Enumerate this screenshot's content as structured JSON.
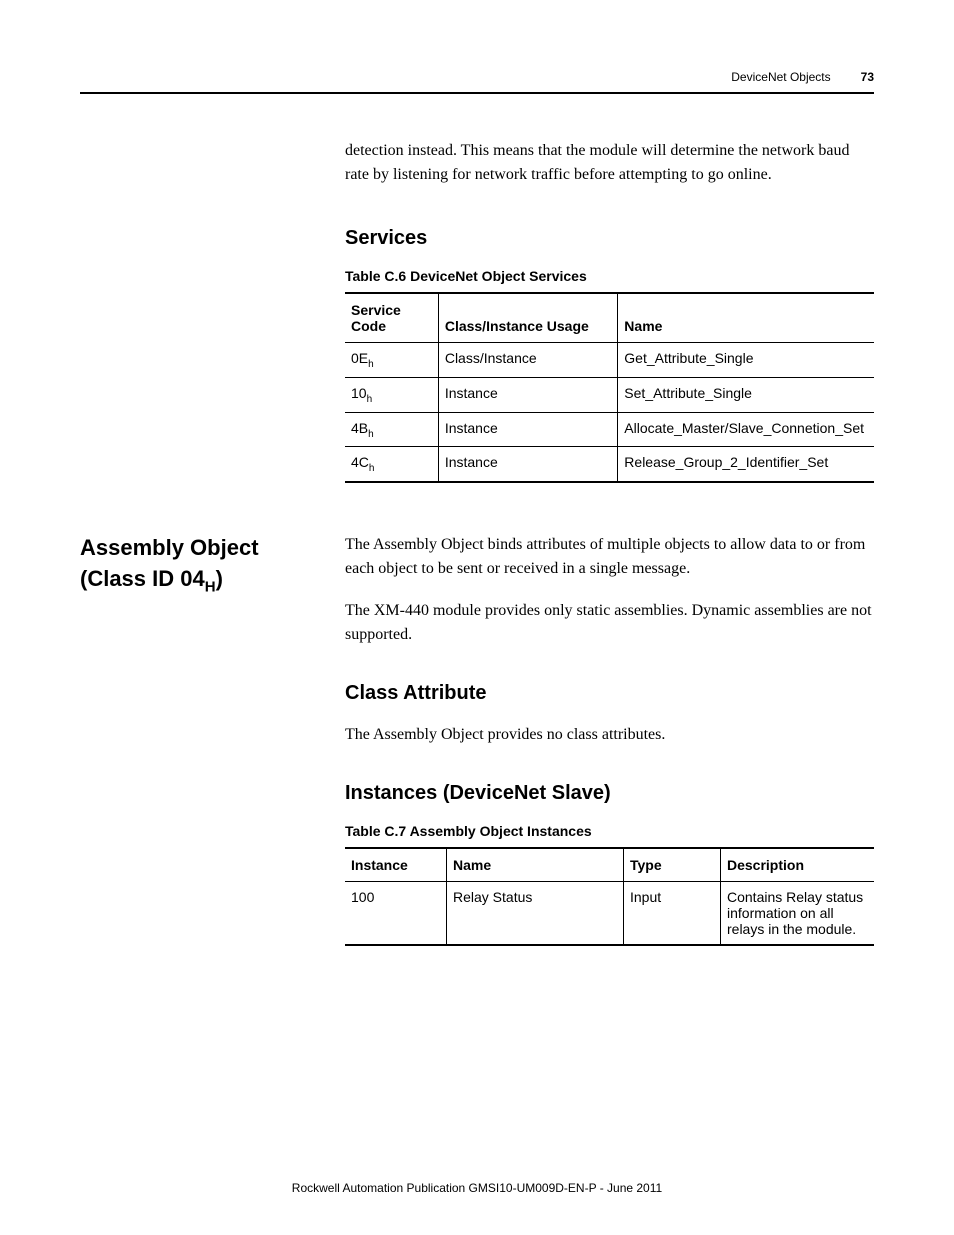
{
  "header": {
    "section": "DeviceNet Objects",
    "page": "73"
  },
  "intro_paragraph": "detection instead. This means that the module will determine the network baud rate by listening for network traffic before attempting to go online.",
  "services": {
    "heading": "Services",
    "table_caption": "Table C.6 DeviceNet Object Services",
    "columns": {
      "code": "Service Code",
      "usage": "Class/Instance Usage",
      "name": "Name"
    },
    "rows": [
      {
        "code_main": "0E",
        "code_sub": "h",
        "usage": "Class/Instance",
        "name": "Get_Attribute_Single"
      },
      {
        "code_main": "10",
        "code_sub": "h",
        "usage": "Instance",
        "name": "Set_Attribute_Single"
      },
      {
        "code_main": "4B",
        "code_sub": "h",
        "usage": "Instance",
        "name": "Allocate_Master/Slave_Connetion_Set"
      },
      {
        "code_main": "4C",
        "code_sub": "h",
        "usage": "Instance",
        "name": "Release_Group_2_Identifier_Set"
      }
    ]
  },
  "assembly": {
    "side_heading_line1": "Assembly Object",
    "side_heading_line2a": "(Class ID 04",
    "side_heading_line2b": "H",
    "side_heading_line2c": ")",
    "para1": "The Assembly Object binds attributes of multiple objects to allow data to or from each object to be sent or received in a single message.",
    "para2": "The XM-440 module provides only static assemblies. Dynamic assemblies are not supported.",
    "class_attr_heading": "Class Attribute",
    "class_attr_para": "The Assembly Object provides no class attributes.",
    "instances_heading": "Instances (DeviceNet Slave)",
    "table_caption": "Table C.7 Assembly Object Instances",
    "columns": {
      "instance": "Instance",
      "name": "Name",
      "type": "Type",
      "description": "Description"
    },
    "rows": [
      {
        "instance": "100",
        "name": "Relay Status",
        "type": "Input",
        "description": "Contains Relay status information on all relays in the module."
      }
    ]
  },
  "footer": "Rockwell Automation Publication GMSI10-UM009D-EN-P - June 2011"
}
